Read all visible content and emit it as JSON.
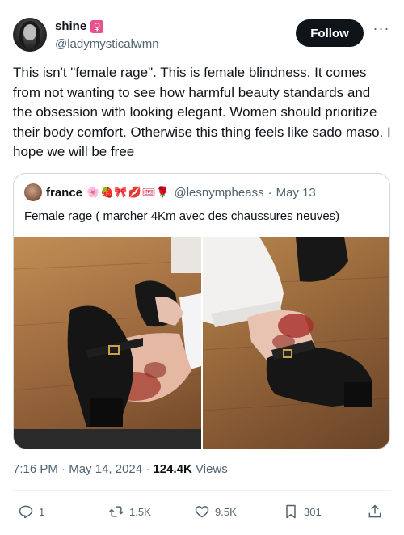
{
  "author": {
    "name": "shine",
    "badge_symbol": "♀",
    "handle": "@ladymysticalwmn",
    "follow_label": "Follow",
    "more_label": "···"
  },
  "tweet": {
    "text": "This isn't \"female rage\". This is female blindness. It comes from not wanting to see how harmful beauty standards and the obsession with looking elegant. Women should prioritize their body comfort. Otherwise this thing feels like sado maso. I hope we will be free"
  },
  "quoted": {
    "name": "france",
    "emojis": "🌸🍓🎀💋🎟🌹",
    "handle": "@lesnympheass",
    "dot": "·",
    "date": "May 13",
    "text": "Female rage ( marcher 4Km avec des chaussures neuves)"
  },
  "meta": {
    "time": "7:16 PM",
    "sep1": "·",
    "date": "May 14, 2024",
    "sep2": "·",
    "views_count": "124.4K",
    "views_label": "Views"
  },
  "actions": {
    "replies": "1",
    "reposts": "1.5K",
    "likes": "9.5K",
    "bookmarks": "301"
  },
  "colors": {
    "text": "#0f1419",
    "secondary": "#536471",
    "border": "#cfd9de",
    "badge": "#e8508f"
  }
}
